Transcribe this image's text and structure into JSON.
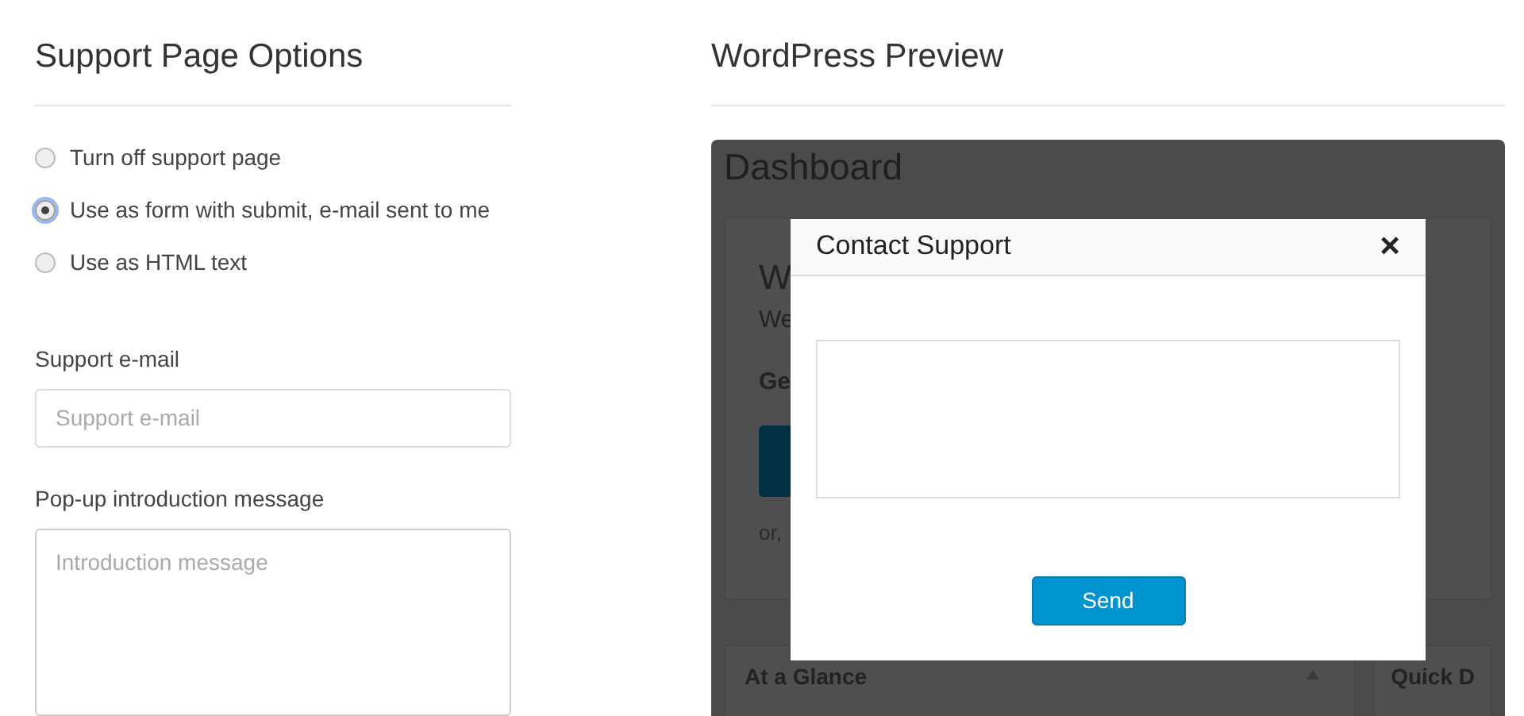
{
  "options_panel": {
    "title": "Support Page Options",
    "radios": [
      {
        "label": "Turn off support page",
        "selected": false
      },
      {
        "label": "Use as form with submit, e-mail sent to me",
        "selected": true
      },
      {
        "label": "Use as HTML text",
        "selected": false
      }
    ],
    "email": {
      "label": "Support e-mail",
      "placeholder": "Support e-mail"
    },
    "intro": {
      "label": "Pop-up introduction message",
      "placeholder": "Introduction message"
    }
  },
  "preview_panel": {
    "title": "WordPress Preview",
    "dashboard": {
      "title": "Dashboard",
      "welcome_heading": "W",
      "welcome_subheading": "We",
      "get_started": "Ge",
      "or_text": "or,",
      "widgets": [
        {
          "title": "At a Glance"
        },
        {
          "title": "Quick D"
        }
      ]
    },
    "modal": {
      "title": "Contact Support",
      "close": "×",
      "button": "Send"
    }
  }
}
